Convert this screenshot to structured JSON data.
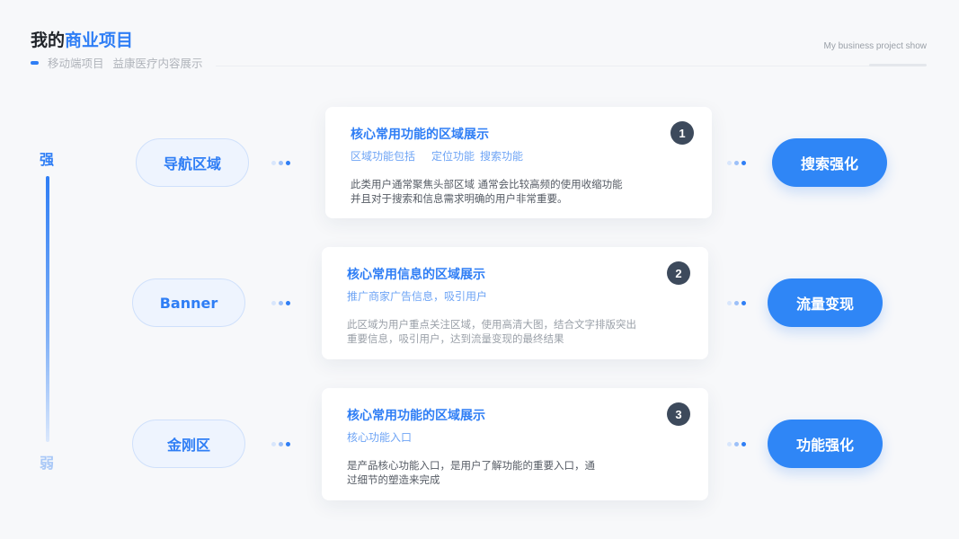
{
  "header": {
    "title_prefix": "我的",
    "title_accent": "商业项目",
    "subtitle_part1": "移动端项目",
    "subtitle_part2": "益康医疗内容展示",
    "english_caption": "My business project show"
  },
  "axis": {
    "strong_label": "强",
    "weak_label": "弱"
  },
  "rows": [
    {
      "left_label": "导航区域",
      "right_label": "搜索强化",
      "number": "1",
      "card_title": "核心常用功能的区域展示",
      "tags": [
        "区域功能包括",
        "定位功能",
        "搜索功能"
      ],
      "desc_line1": "此类用户通常聚焦头部区域 通常会比较高频的使用收缩功能",
      "desc_line2": "并且对于搜索和信息需求明确的用户非常重要。"
    },
    {
      "left_label": "Banner",
      "right_label": "流量变现",
      "number": "2",
      "card_title": "核心常用信息的区域展示",
      "tags": [
        "推广商家广告信息，吸引用户"
      ],
      "desc_line1": "此区域为用户重点关注区域，使用高清大图，结合文字排版突出",
      "desc_line2": "重要信息，吸引用户，达到流量变现的最终结果"
    },
    {
      "left_label": "金刚区",
      "right_label": "功能强化",
      "number": "3",
      "card_title": "核心常用功能的区域展示",
      "tags": [
        "核心功能入口"
      ],
      "desc_line1": "是产品核心功能入口，是用户了解功能的重要入口，通",
      "desc_line2": "过细节的塑造来完成"
    }
  ],
  "colors": {
    "accent": "#2f7ef5",
    "badge": "#3d4a5c"
  }
}
